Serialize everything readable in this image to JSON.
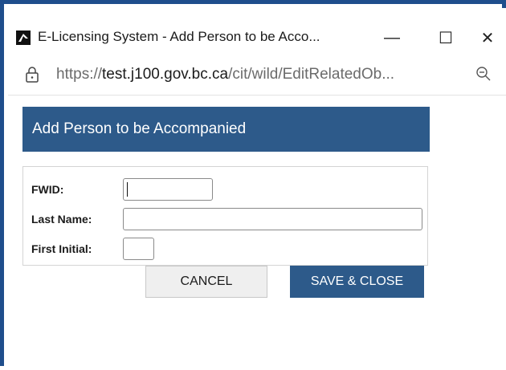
{
  "window": {
    "title": "E-Licensing System - Add Person to be Acco...",
    "minimize_glyph": "—",
    "maximize_glyph": "☐",
    "close_glyph": "✕"
  },
  "address_bar": {
    "scheme": "https://",
    "host": "test.j100.gov.bc.ca",
    "path": "/cit/wild/EditRelatedOb..."
  },
  "dialog": {
    "title": "Add Person to be Accompanied",
    "fields": {
      "fwid_label": "FWID:",
      "fwid_value": "",
      "last_name_label": "Last Name:",
      "last_name_value": "",
      "first_initial_label": "First Initial:",
      "first_initial_value": ""
    },
    "buttons": {
      "cancel": "CANCEL",
      "save_close": "SAVE & CLOSE"
    }
  },
  "colors": {
    "accent": "#2d5a8a",
    "window_border": "#1f4e8c"
  },
  "icons": [
    "app-icon",
    "lock-icon",
    "zoom-icon"
  ]
}
